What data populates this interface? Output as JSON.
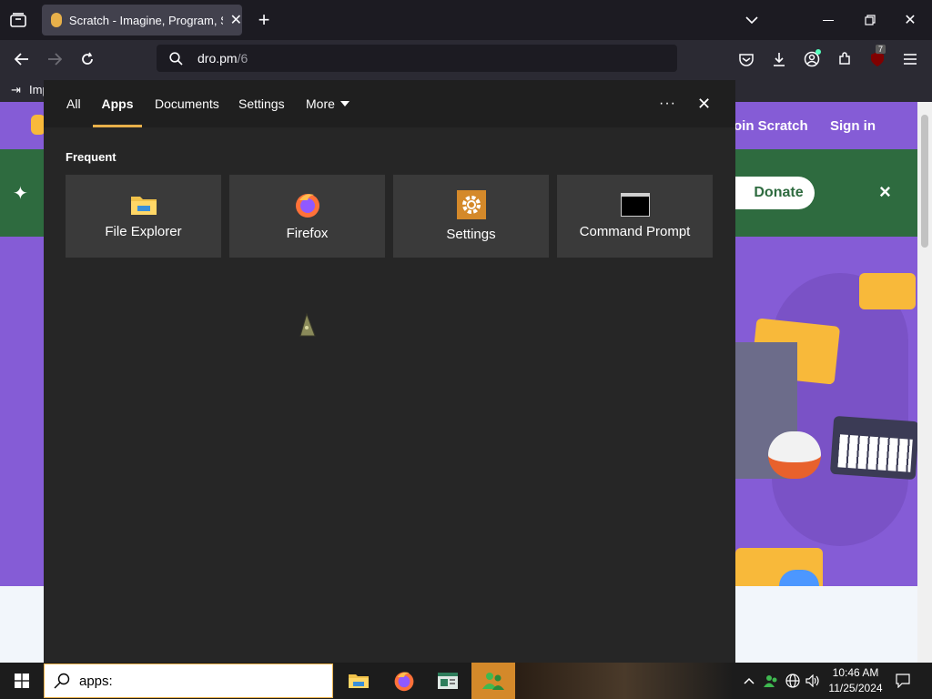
{
  "browser": {
    "tab_title": "Scratch - Imagine, Program, Sh",
    "url_host": "dro.pm",
    "url_path": "/6",
    "bookmark_label": "Imp",
    "extension_badge": "7"
  },
  "scratch_page": {
    "join_label": "oin Scratch",
    "signin_label": "Sign in",
    "donate_label": "Donate",
    "close_banner": "×"
  },
  "start_menu": {
    "tabs": [
      {
        "label": "All"
      },
      {
        "label": "Apps"
      },
      {
        "label": "Documents"
      },
      {
        "label": "Settings"
      },
      {
        "label": "More"
      }
    ],
    "active_tab": "Apps",
    "more_options": "···",
    "close_glyph": "✕",
    "section_title": "Frequent",
    "tiles": [
      {
        "label": "File Explorer",
        "icon": "folder-icon"
      },
      {
        "label": "Firefox",
        "icon": "firefox-icon"
      },
      {
        "label": "Settings",
        "icon": "gear-icon"
      },
      {
        "label": "Command Prompt",
        "icon": "terminal-icon"
      }
    ]
  },
  "taskbar": {
    "search_value": "apps:",
    "clock_time": "10:46 AM",
    "clock_date": "11/25/2024"
  },
  "colors": {
    "scratch_purple": "#855cd6",
    "donate_banner": "#2e6b3f",
    "active_tab_underline": "#e8b04a"
  }
}
